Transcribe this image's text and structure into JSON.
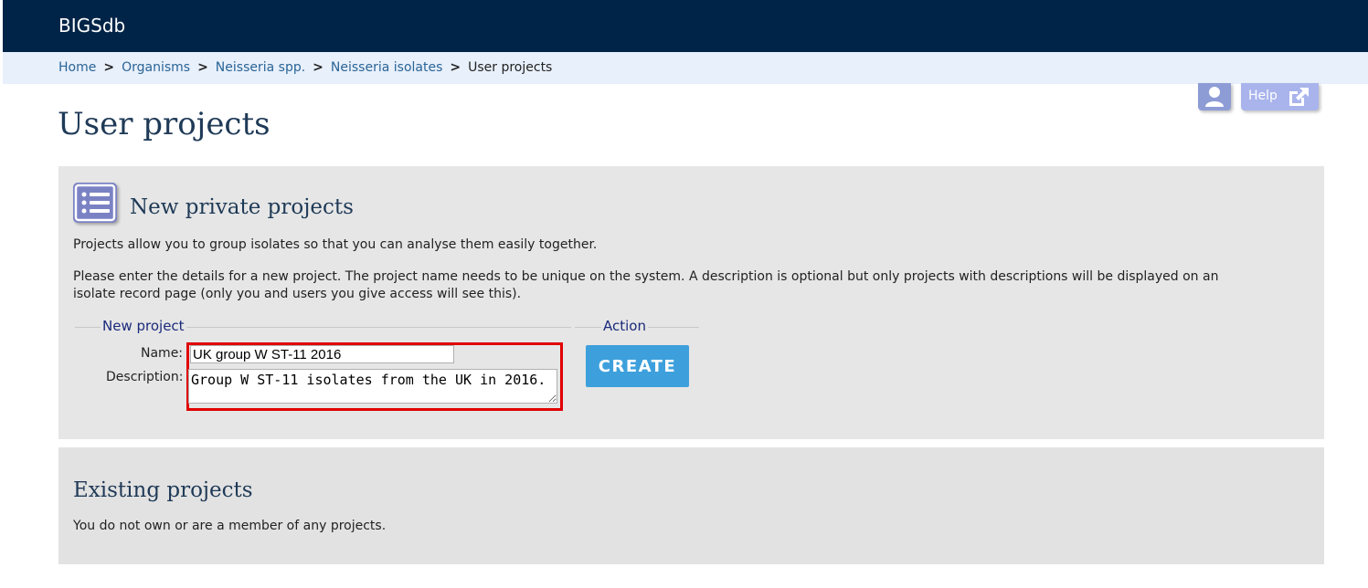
{
  "header": {
    "brand": "BIGSdb"
  },
  "breadcrumb": {
    "items": [
      "Home",
      "Organisms",
      "Neisseria spp.",
      "Neisseria isolates"
    ],
    "current": "User projects",
    "separator": ">"
  },
  "toolbar": {
    "help_label": "Help"
  },
  "page_title": "User projects",
  "new_projects": {
    "heading": "New private projects",
    "intro": "Projects allow you to group isolates so that you can analyse them easily together.",
    "instructions": "Please enter the details for a new project. The project name needs to be unique on the system. A description is optional but only projects with descriptions will be displayed on an isolate record page (only you and users you give access will see this).",
    "form": {
      "legend": "New project",
      "name_label": "Name:",
      "name_value": "UK group W ST-11 2016",
      "description_label": "Description:",
      "description_value": "Group W ST-11 isolates from the UK in 2016."
    },
    "action": {
      "legend": "Action",
      "create_label": "CREATE"
    }
  },
  "existing_projects": {
    "heading": "Existing projects",
    "message": "You do not own or are a member of any projects."
  },
  "colors": {
    "topbar": "#002447",
    "breadcrumb_bg": "#e8f0fb",
    "panel_bg": "#e6e6e6",
    "create_button": "#3da0dc",
    "highlight_border": "#e00000",
    "icon_purple": "#7b82c4"
  },
  "icons": [
    "user-icon",
    "external-link-icon",
    "list-icon"
  ]
}
